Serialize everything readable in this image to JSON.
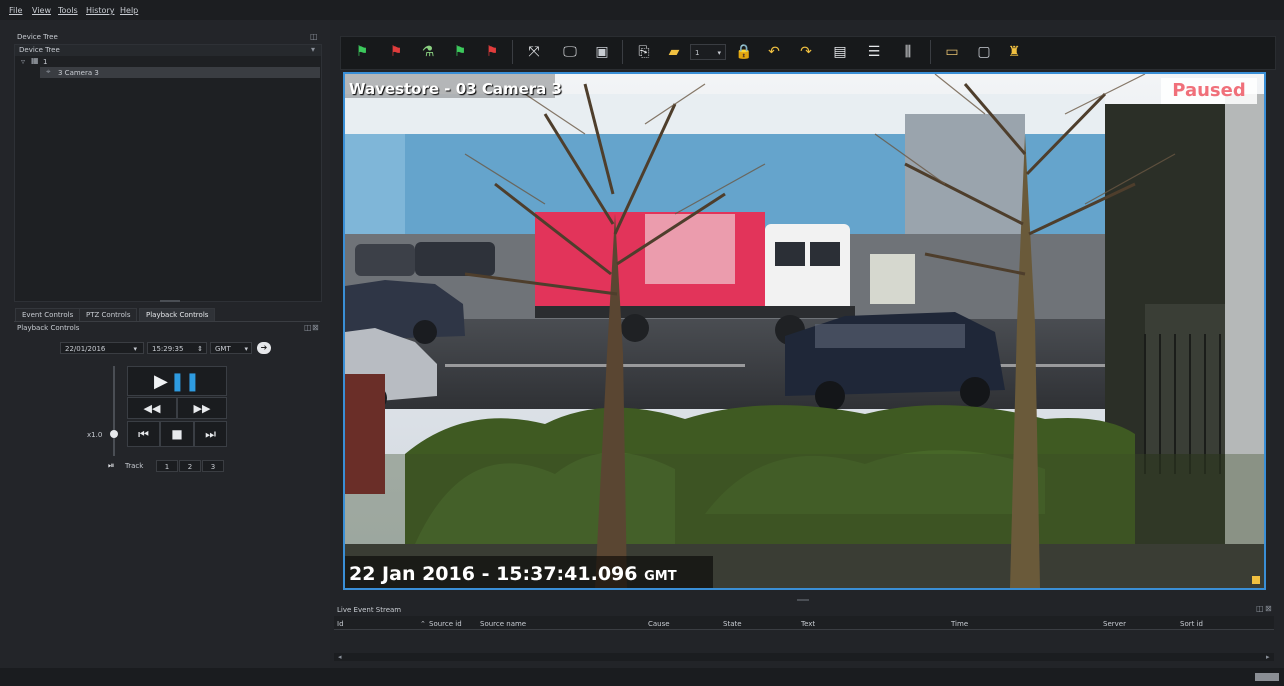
{
  "menu": {
    "file": "File",
    "view": "View",
    "tools": "Tools",
    "history": "History",
    "help": "Help"
  },
  "device_tree": {
    "panel_title": "Device Tree",
    "dropdown_value": "Device Tree",
    "node_label": "1",
    "camera_label": "3 Camera 3"
  },
  "tabs": {
    "event": "Event Controls",
    "ptz": "PTZ Controls",
    "playback": "Playback Controls"
  },
  "playback": {
    "title": "Playback Controls",
    "date": "22/01/2016",
    "time": "15:29:35",
    "timezone": "GMT",
    "speed": "x1.0",
    "track_label": "Track",
    "tracks": [
      "1",
      "2",
      "3"
    ]
  },
  "toolbar": {
    "page_selector_value": "1",
    "icons": [
      "flag-green-icon",
      "flag-red-icon",
      "network-icon",
      "flag-green-skip-icon",
      "flag-red-skip-icon",
      "fullscreen-icon",
      "monitor-icon",
      "screenshot-icon",
      "export-icon",
      "folder-icon",
      "lock-icon",
      "undo-icon",
      "redo-icon",
      "layout-icon",
      "list-icon",
      "settings-icon",
      "monitor-icon",
      "screen-icon",
      "alarm-icon"
    ]
  },
  "video": {
    "camera_title": "Wavestore - 03 Camera 3",
    "status": "Paused",
    "timestamp": "22 Jan 2016 - 15:37:41.096",
    "timestamp_tz": "GMT"
  },
  "event_stream": {
    "title": "Live Event Stream",
    "columns": [
      "Id",
      "Source id",
      "Source name",
      "Cause",
      "State",
      "Text",
      "Time",
      "Server",
      "Sort id"
    ]
  },
  "colors": {
    "accent": "#3a8fd6",
    "paused": "#f0707a",
    "background": "#222428"
  }
}
